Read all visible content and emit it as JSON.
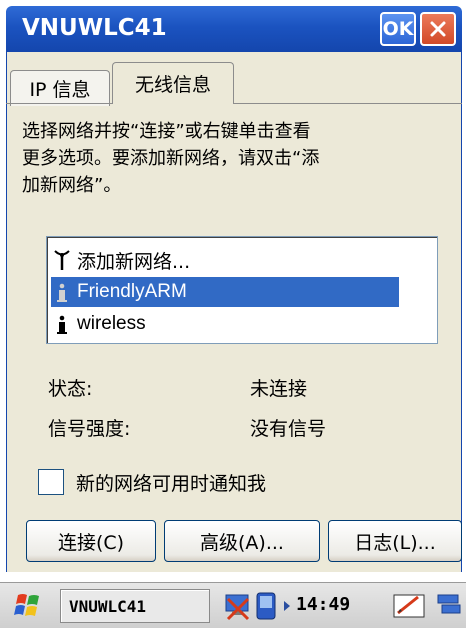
{
  "window": {
    "title": "VNUWLC41",
    "ok_label": "OK"
  },
  "tabs": [
    {
      "label": "IP 信息",
      "active": false
    },
    {
      "label": "无线信息",
      "active": true
    }
  ],
  "description": {
    "line1": "选择网络并按“连接”或右键单击查看",
    "line2": "更多选项。要添加新网络，请双击“添",
    "line3": "加新网络”。"
  },
  "networks": [
    {
      "label": "添加新网络...",
      "icon": "antenna-icon",
      "selected": false
    },
    {
      "label": "FriendlyARM",
      "icon": "signal-icon",
      "selected": true
    },
    {
      "label": "wireless",
      "icon": "signal-icon",
      "selected": false
    }
  ],
  "status": {
    "state_label": "状态:",
    "state_value": "未连接",
    "signal_label": "信号强度:",
    "signal_value": "没有信号"
  },
  "notify": {
    "label": "新的网络可用时通知我",
    "checked": false
  },
  "buttons": {
    "connect": "连接(C)",
    "advanced": "高级(A)...",
    "log": "日志(L)..."
  },
  "taskbar": {
    "task_label": "VNUWLC41",
    "clock": "14:49"
  },
  "colors": {
    "titlebar": "#1b53c0",
    "selection": "#316ac5",
    "window_bg": "#ece9d8"
  }
}
